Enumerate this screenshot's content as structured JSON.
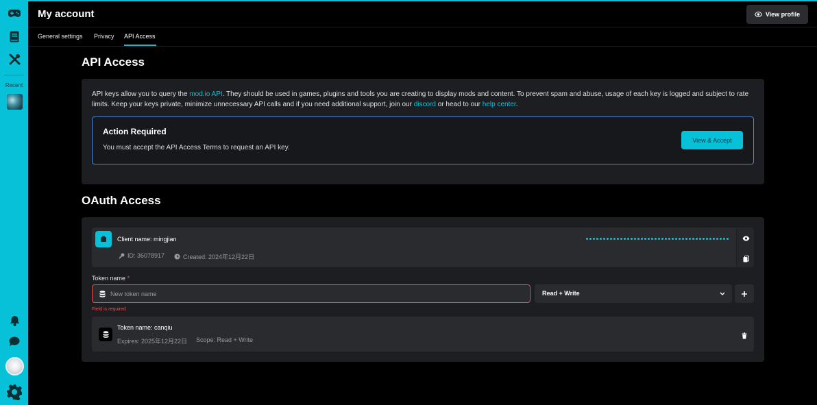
{
  "header": {
    "title": "My account",
    "view_profile_label": "View profile"
  },
  "tabs": [
    {
      "label": "General settings",
      "active": false
    },
    {
      "label": "Privacy",
      "active": false
    },
    {
      "label": "API Access",
      "active": true
    }
  ],
  "sidebar": {
    "recent_label": "Recent",
    "items": [
      {
        "icon": "gamepad-icon"
      },
      {
        "icon": "book-icon"
      },
      {
        "icon": "tools-icon"
      }
    ],
    "bottom_items": [
      {
        "icon": "bell-icon"
      },
      {
        "icon": "chat-icon"
      },
      {
        "icon": "avatar"
      },
      {
        "icon": "settings-gear-icon"
      }
    ]
  },
  "api_access": {
    "heading": "API Access",
    "intro": {
      "t1": "API keys allow you to query the ",
      "link1": "mod.io API",
      "t2": ". They should be used in games, plugins and tools you are creating to display mods and content. To prevent spam and abuse, usage of each key is logged and subject to rate limits. Keep your keys private, minimize unnecessary API calls and if you need additional support, join our ",
      "link2": "discord",
      "t3": " or head to our ",
      "link3": "help center",
      "t4": "."
    },
    "action": {
      "title": "Action Required",
      "text": "You must accept the API Access Terms to request an API key.",
      "button": "View & Accept"
    }
  },
  "oauth": {
    "heading": "OAuth Access",
    "client": {
      "name": "Client name: mingjian",
      "id": "ID: 36078917",
      "created": "Created: 2024年12月22日"
    },
    "token_label": "Token name",
    "required_mark": "*",
    "token_placeholder": "New token name",
    "scope_selected": "Read + Write",
    "error": "Field is required",
    "tokens": [
      {
        "name": "Token name: canqiu",
        "expires": "Expires: 2025年12月22日",
        "scope": "Scope: Read + Write"
      }
    ]
  },
  "colors": {
    "accent": "#07c1d8",
    "error": "#e05555",
    "panel": "#1d1e21",
    "notice_border": "#4f86d6"
  }
}
